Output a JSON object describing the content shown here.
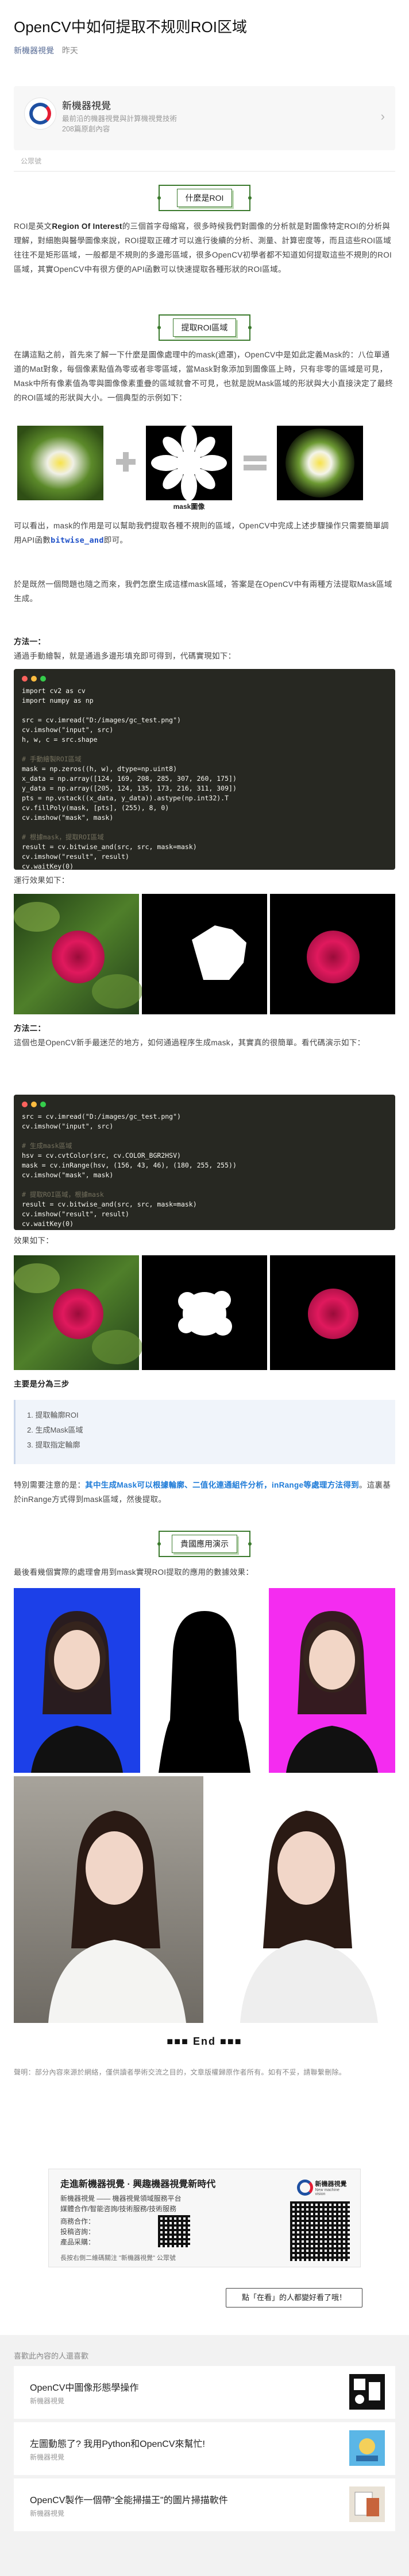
{
  "header": {
    "title": "OpenCV中如何提取不规则ROI区域",
    "account": "新機器視覺",
    "time": "昨天"
  },
  "profile": {
    "name": "新機器視覺",
    "description": "最前沿的機器視覺與計算機視覺技術",
    "count": "208篇原創內容",
    "follow_label": "公眾號"
  },
  "sections": {
    "s1": "什麼是ROI",
    "s2": "提取ROI區域",
    "s3": "貴國應用演示"
  },
  "paragraphs": {
    "p1a": "ROI是英文",
    "p1b": "Region Of Interest",
    "p1c": "的三個首字母縮寫，很多時候我們對圖像的分析就是對圖像特定ROI的分析與理解，對細胞與醫學圖像來說，ROI提取正確才可以進行後續的分析、測量、計算密度等，而且這些ROI區域往往不是矩形區域，一般都是不規則的多邊形區域，很多OpenCV初學者都不知道如何提取這些不規則的ROI區域，其實OpenCV中有很方便的API函數可以快速提取各種形狀的ROI區域。",
    "p2": "在講這點之前，首先來了解一下什麼是圖像處理中的mask(遮罩)，OpenCV中是如此定義Mask的：八位單通道的Mat對象，每個像素點值為零或者非零區域，當Mask對象添加到圖像區上時，只有非零的區域是可見，Mask中所有像素值為零與圖像像素重疊的區域就會不可見，也就是說Mask區域的形狀與大小直接決定了最終的ROI區域的形狀與大小。一個典型的示例如下：",
    "p3a": "可以看出，mask的作用是可以幫助我們提取各種不規則的區域，OpenCV中完成上述步驟操作只需要簡單調用API函數",
    "p3b": "bitwise_and",
    "p3c": "即可。",
    "p4": "於是既然一個問題也隨之而來，我們怎麼生成這樣mask區域，答案是在OpenCV中有兩種方法提取Mask區域生成。",
    "m1": "方法一：",
    "m1d": "通過手動繪製，就是通過多邊形填充即可得到，代碼實現如下：",
    "r1": "運行效果如下：",
    "m2": "方法二：",
    "m2d": "這個也是OpenCV新手最迷茫的地方，如何通過程序生成mask，其實真的很簡單。看代碼演示如下：",
    "r2": "效果如下：",
    "steps_title": "主要是分為三步",
    "p5a": "特別需要注意的是：",
    "p5b": "其中生成Mask可以根據輪廓、二值化連通組件分析，inRange等處理方法得到",
    "p5c": "。這裏基於inRange方式得到mask區域，然後提取。",
    "p6": "最後看幾個實際的處理會用到mask實現ROI提取的應用的數據效果：",
    "credit": "聲明：部分內容來源於網絡，僅供讀者學術交流之目的，文章版權歸原作者所有。如有不妥，請聯繫刪除。"
  },
  "code1": [
    "import cv2 as cv",
    "import numpy as np",
    "",
    "src = cv.imread(\"D:/images/gc_test.png\")",
    "cv.imshow(\"input\", src)",
    "h, w, c = src.shape",
    "",
    "# 手動繪製ROI區域",
    "mask = np.zeros((h, w), dtype=np.uint8)",
    "x_data = np.array([124, 169, 208, 285, 307, 260, 175])",
    "y_data = np.array([205, 124, 135, 173, 216, 311, 309])",
    "pts = np.vstack((x_data, y_data)).astype(np.int32).T",
    "cv.fillPoly(mask, [pts], (255), 8, 0)",
    "cv.imshow(\"mask\", mask)",
    "",
    "# 根據mask，提取ROI區域",
    "result = cv.bitwise_and(src, src, mask=mask)",
    "cv.imshow(\"result\", result)",
    "cv.waitKey(0)"
  ],
  "code2": [
    "src = cv.imread(\"D:/images/gc_test.png\")",
    "cv.imshow(\"input\", src)",
    "",
    "# 生成mask區域",
    "hsv = cv.cvtColor(src, cv.COLOR_BGR2HSV)",
    "mask = cv.inRange(hsv, (156, 43, 46), (180, 255, 255))",
    "cv.imshow(\"mask\", mask)",
    "",
    "# 提取ROI區域，根據mask",
    "result = cv.bitwise_and(src, src, mask=mask)",
    "cv.imshow(\"result\", result)",
    "cv.waitKey(0)"
  ],
  "steps": [
    "1. 提取輪廓ROI",
    "2. 生成Mask區域",
    "3. 提取指定輪廓"
  ],
  "diagram": {
    "mask_label": "mask圖像"
  },
  "end_text": "■■■ End ■■■",
  "promo": {
    "title": "走進新機器視覺 · 興趣機器視覺新時代",
    "lines": [
      "新機器視覺 —— 機器視覺領域服務平台",
      "媒體合作/智能咨詢/技術服務/技術服務",
      "商務合作：",
      "投稿咨詢：",
      "產品采購：",
      "長按右側二維碼關注 \"新機器視覺\" 公眾號"
    ],
    "brand": "新機器視覺",
    "brand_sub": "New machine vision"
  },
  "like_button": "點「在看」的人都變好看了哦！",
  "recommend": {
    "title": "喜歡此內容的人還喜歡",
    "items": [
      {
        "title": "OpenCV中圖像形態學操作",
        "author": "新機器視覺"
      },
      {
        "title": "左圖動態了? 我用Python和OpenCV來幫忙!",
        "author": "新機器視覺"
      },
      {
        "title": "OpenCV製作一個帶\"全能掃描王\"的圖片掃描軟件",
        "author": "新機器視覺"
      }
    ]
  }
}
